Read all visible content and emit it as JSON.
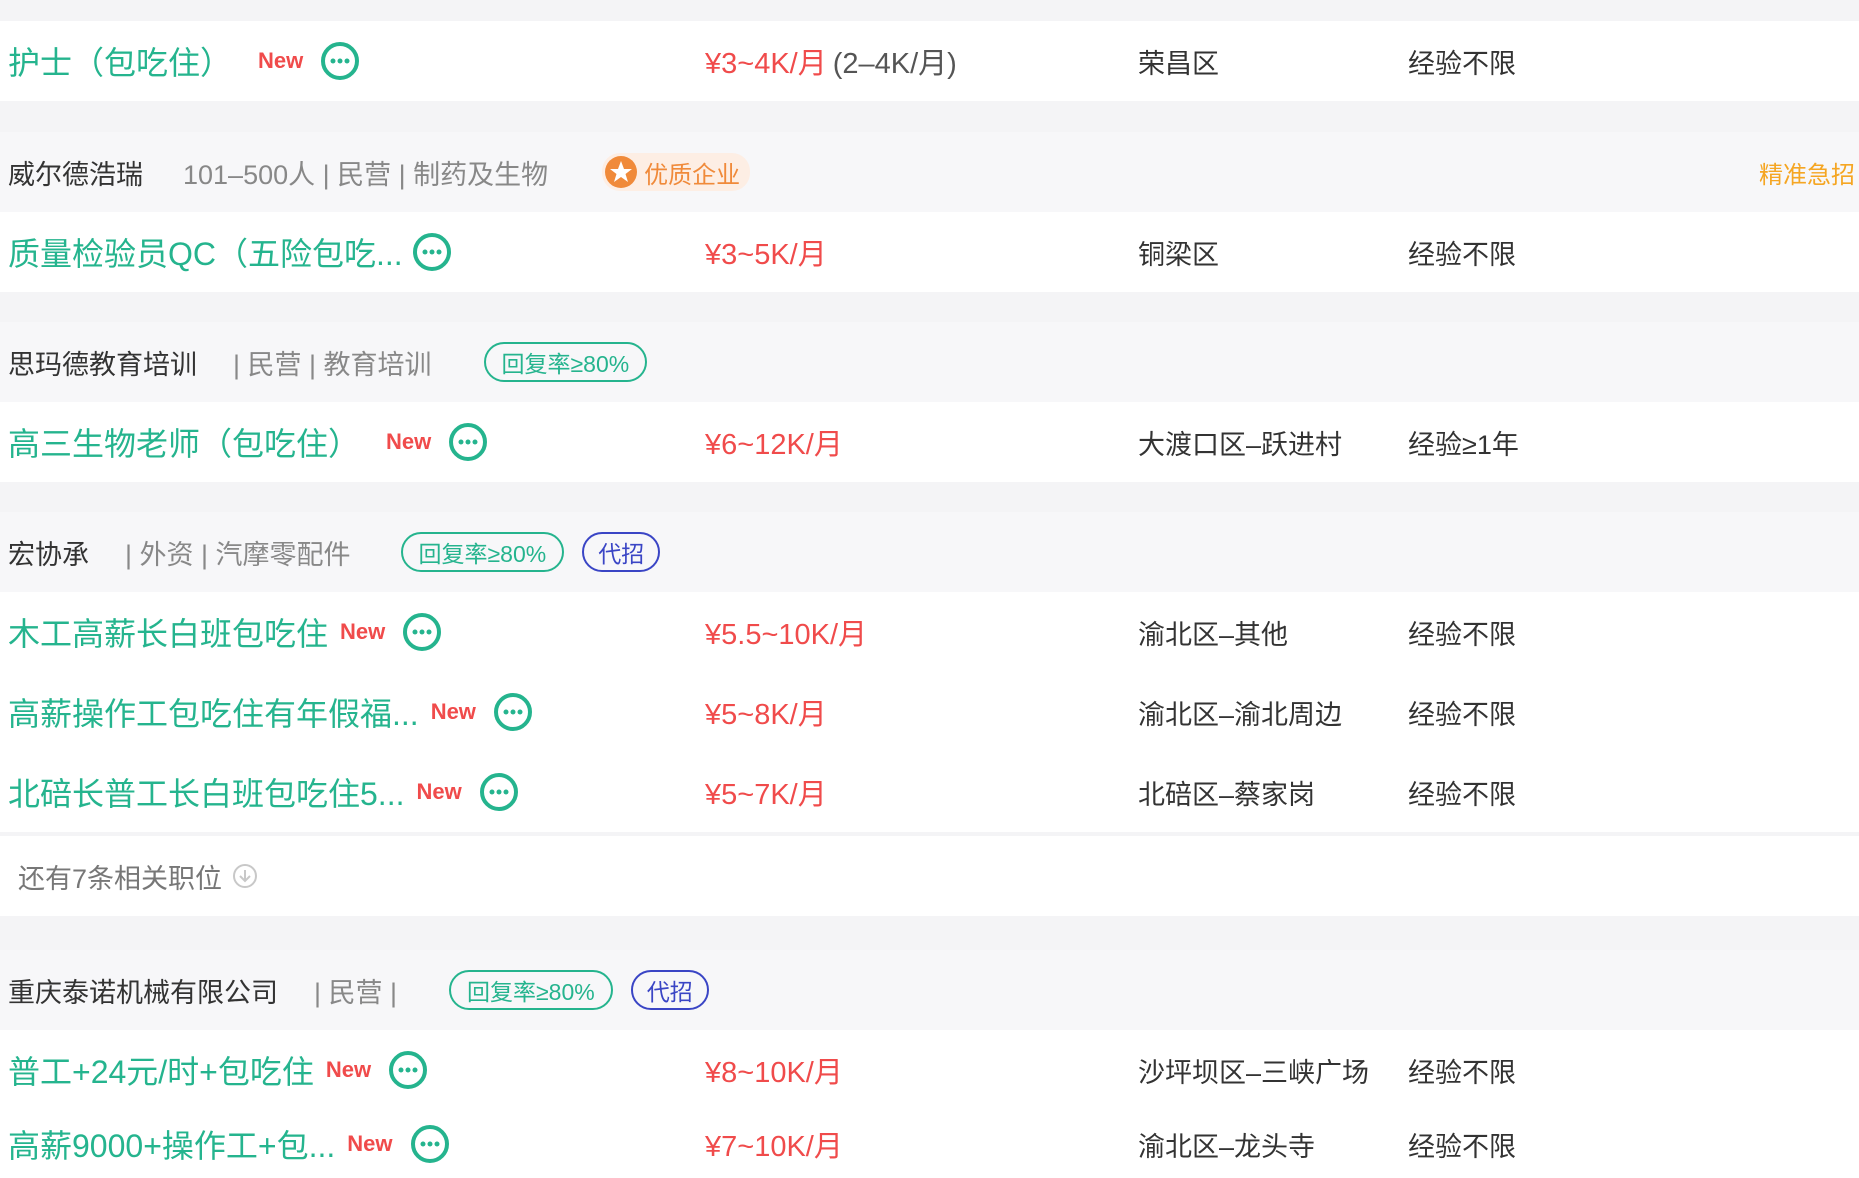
{
  "rows": [
    {
      "kind": "job",
      "title": "护士（包吃住）",
      "new": "New",
      "salary": "¥3~4K/月",
      "salary_sub": "(2–4K/月)",
      "location": "荣昌区",
      "experience": "经验不限"
    },
    {
      "kind": "company",
      "name": "威尔德浩瑞",
      "info": "101–500人 | 民营 | 制药及生物",
      "quality": "优质企业",
      "urgent": "精准急招"
    },
    {
      "kind": "job",
      "title": "质量检验员QC（五险包吃...",
      "salary": "¥3~5K/月",
      "location": "铜梁区",
      "experience": "经验不限"
    },
    {
      "kind": "company",
      "name": "思玛德教育培训",
      "info": "| 民营 | 教育培训",
      "reply": "回复率≥80%"
    },
    {
      "kind": "job",
      "title": "高三生物老师（包吃住）",
      "new": "New",
      "salary": "¥6~12K/月",
      "location": "大渡口区–跃进村",
      "experience": "经验≥1年"
    },
    {
      "kind": "company",
      "name": "宏协承",
      "info": "| 外资 | 汽摩零配件",
      "reply": "回复率≥80%",
      "agent": "代招"
    },
    {
      "kind": "job",
      "title": "木工高薪长白班包吃住",
      "new": "New",
      "salary": "¥5.5~10K/月",
      "location": "渝北区–其他",
      "experience": "经验不限"
    },
    {
      "kind": "job",
      "title": "高薪操作工包吃住有年假福...",
      "new": "New",
      "salary": "¥5~8K/月",
      "location": "渝北区–渝北周边",
      "experience": "经验不限"
    },
    {
      "kind": "job",
      "title": "北碚长普工长白班包吃住5...",
      "new": "New",
      "salary": "¥5~7K/月",
      "location": "北碚区–蔡家岗",
      "experience": "经验不限"
    },
    {
      "kind": "more",
      "text": "还有7条相关职位"
    },
    {
      "kind": "company",
      "name": "重庆泰诺机械有限公司",
      "info": "| 民营 |",
      "reply": "回复率≥80%",
      "agent": "代招"
    },
    {
      "kind": "job",
      "title": "普工+24元/时+包吃住",
      "new": "New",
      "salary": "¥8~10K/月",
      "location": "沙坪坝区–三峡广场",
      "experience": "经验不限"
    },
    {
      "kind": "job",
      "title": "高薪9000+操作工+包...",
      "new": "New",
      "salary": "¥7~10K/月",
      "location": "渝北区–龙头寺",
      "experience": "经验不限"
    }
  ],
  "colors": {
    "title_green": "#25b48e",
    "salary_red": "#f04b4b",
    "agent_blue": "#3a45c5",
    "quality_orange": "#f08a3a",
    "urgent_yellow": "#f5a623"
  },
  "icons": {
    "chat": "chat-bubble-icon",
    "star": "star-badge-icon",
    "more": "arrow-down-circle-icon"
  }
}
